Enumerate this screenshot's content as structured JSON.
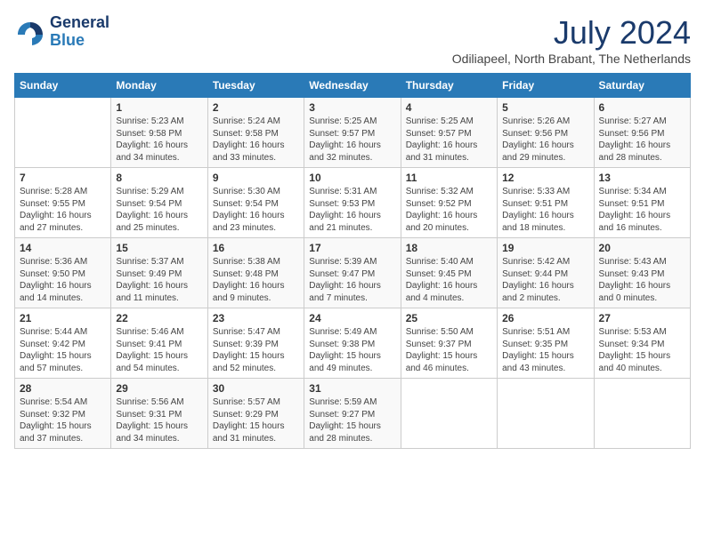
{
  "header": {
    "logo_line1": "General",
    "logo_line2": "Blue",
    "month": "July 2024",
    "location": "Odiliapeel, North Brabant, The Netherlands"
  },
  "weekdays": [
    "Sunday",
    "Monday",
    "Tuesday",
    "Wednesday",
    "Thursday",
    "Friday",
    "Saturday"
  ],
  "weeks": [
    [
      {
        "day": "",
        "info": ""
      },
      {
        "day": "1",
        "info": "Sunrise: 5:23 AM\nSunset: 9:58 PM\nDaylight: 16 hours\nand 34 minutes."
      },
      {
        "day": "2",
        "info": "Sunrise: 5:24 AM\nSunset: 9:58 PM\nDaylight: 16 hours\nand 33 minutes."
      },
      {
        "day": "3",
        "info": "Sunrise: 5:25 AM\nSunset: 9:57 PM\nDaylight: 16 hours\nand 32 minutes."
      },
      {
        "day": "4",
        "info": "Sunrise: 5:25 AM\nSunset: 9:57 PM\nDaylight: 16 hours\nand 31 minutes."
      },
      {
        "day": "5",
        "info": "Sunrise: 5:26 AM\nSunset: 9:56 PM\nDaylight: 16 hours\nand 29 minutes."
      },
      {
        "day": "6",
        "info": "Sunrise: 5:27 AM\nSunset: 9:56 PM\nDaylight: 16 hours\nand 28 minutes."
      }
    ],
    [
      {
        "day": "7",
        "info": "Sunrise: 5:28 AM\nSunset: 9:55 PM\nDaylight: 16 hours\nand 27 minutes."
      },
      {
        "day": "8",
        "info": "Sunrise: 5:29 AM\nSunset: 9:54 PM\nDaylight: 16 hours\nand 25 minutes."
      },
      {
        "day": "9",
        "info": "Sunrise: 5:30 AM\nSunset: 9:54 PM\nDaylight: 16 hours\nand 23 minutes."
      },
      {
        "day": "10",
        "info": "Sunrise: 5:31 AM\nSunset: 9:53 PM\nDaylight: 16 hours\nand 21 minutes."
      },
      {
        "day": "11",
        "info": "Sunrise: 5:32 AM\nSunset: 9:52 PM\nDaylight: 16 hours\nand 20 minutes."
      },
      {
        "day": "12",
        "info": "Sunrise: 5:33 AM\nSunset: 9:51 PM\nDaylight: 16 hours\nand 18 minutes."
      },
      {
        "day": "13",
        "info": "Sunrise: 5:34 AM\nSunset: 9:51 PM\nDaylight: 16 hours\nand 16 minutes."
      }
    ],
    [
      {
        "day": "14",
        "info": "Sunrise: 5:36 AM\nSunset: 9:50 PM\nDaylight: 16 hours\nand 14 minutes."
      },
      {
        "day": "15",
        "info": "Sunrise: 5:37 AM\nSunset: 9:49 PM\nDaylight: 16 hours\nand 11 minutes."
      },
      {
        "day": "16",
        "info": "Sunrise: 5:38 AM\nSunset: 9:48 PM\nDaylight: 16 hours\nand 9 minutes."
      },
      {
        "day": "17",
        "info": "Sunrise: 5:39 AM\nSunset: 9:47 PM\nDaylight: 16 hours\nand 7 minutes."
      },
      {
        "day": "18",
        "info": "Sunrise: 5:40 AM\nSunset: 9:45 PM\nDaylight: 16 hours\nand 4 minutes."
      },
      {
        "day": "19",
        "info": "Sunrise: 5:42 AM\nSunset: 9:44 PM\nDaylight: 16 hours\nand 2 minutes."
      },
      {
        "day": "20",
        "info": "Sunrise: 5:43 AM\nSunset: 9:43 PM\nDaylight: 16 hours\nand 0 minutes."
      }
    ],
    [
      {
        "day": "21",
        "info": "Sunrise: 5:44 AM\nSunset: 9:42 PM\nDaylight: 15 hours\nand 57 minutes."
      },
      {
        "day": "22",
        "info": "Sunrise: 5:46 AM\nSunset: 9:41 PM\nDaylight: 15 hours\nand 54 minutes."
      },
      {
        "day": "23",
        "info": "Sunrise: 5:47 AM\nSunset: 9:39 PM\nDaylight: 15 hours\nand 52 minutes."
      },
      {
        "day": "24",
        "info": "Sunrise: 5:49 AM\nSunset: 9:38 PM\nDaylight: 15 hours\nand 49 minutes."
      },
      {
        "day": "25",
        "info": "Sunrise: 5:50 AM\nSunset: 9:37 PM\nDaylight: 15 hours\nand 46 minutes."
      },
      {
        "day": "26",
        "info": "Sunrise: 5:51 AM\nSunset: 9:35 PM\nDaylight: 15 hours\nand 43 minutes."
      },
      {
        "day": "27",
        "info": "Sunrise: 5:53 AM\nSunset: 9:34 PM\nDaylight: 15 hours\nand 40 minutes."
      }
    ],
    [
      {
        "day": "28",
        "info": "Sunrise: 5:54 AM\nSunset: 9:32 PM\nDaylight: 15 hours\nand 37 minutes."
      },
      {
        "day": "29",
        "info": "Sunrise: 5:56 AM\nSunset: 9:31 PM\nDaylight: 15 hours\nand 34 minutes."
      },
      {
        "day": "30",
        "info": "Sunrise: 5:57 AM\nSunset: 9:29 PM\nDaylight: 15 hours\nand 31 minutes."
      },
      {
        "day": "31",
        "info": "Sunrise: 5:59 AM\nSunset: 9:27 PM\nDaylight: 15 hours\nand 28 minutes."
      },
      {
        "day": "",
        "info": ""
      },
      {
        "day": "",
        "info": ""
      },
      {
        "day": "",
        "info": ""
      }
    ]
  ]
}
